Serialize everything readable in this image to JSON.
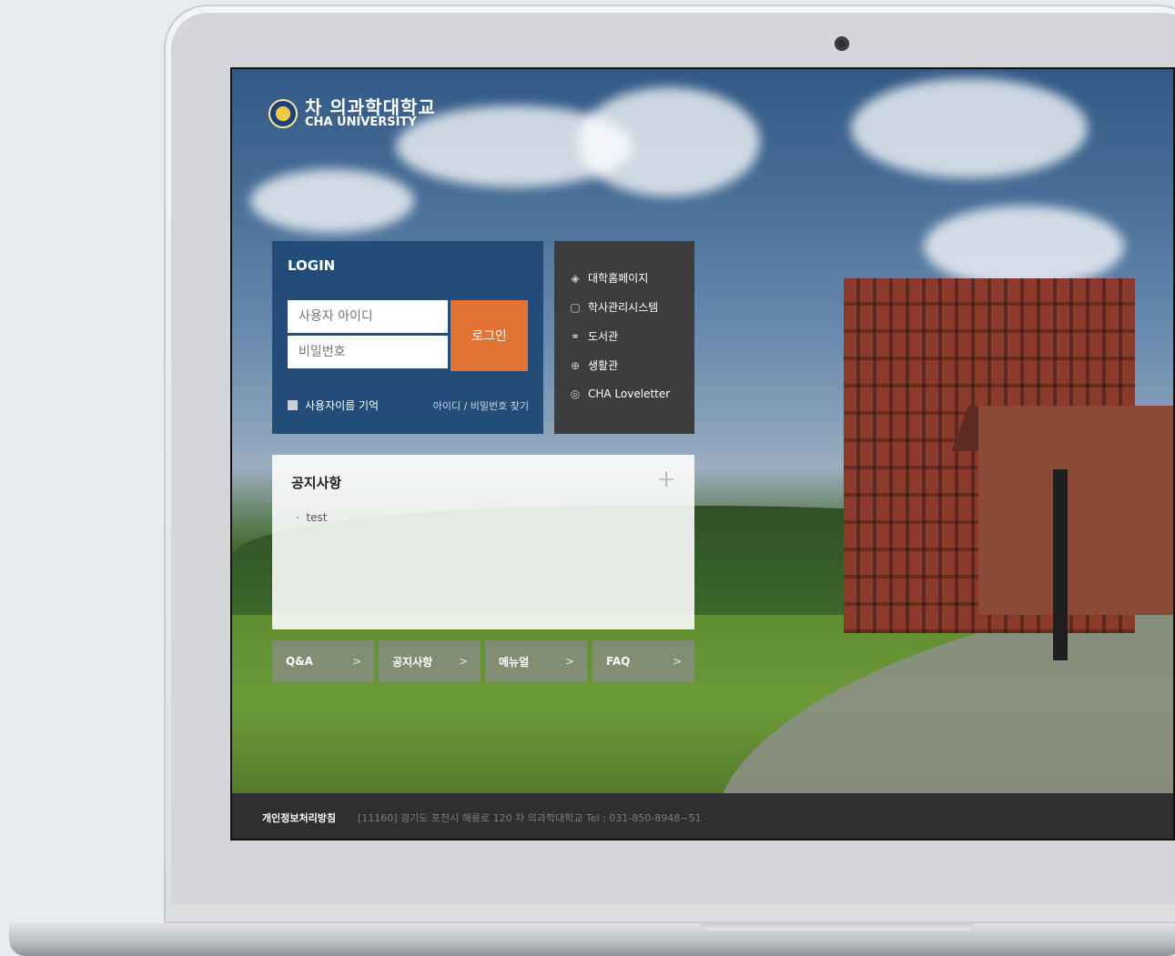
{
  "logo": {
    "name_ko": "차 의과학대학교",
    "name_en": "CHA UNIVERSITY"
  },
  "login": {
    "title": "LOGIN",
    "id_placeholder": "사용자 아이디",
    "pw_placeholder": "비밀번호",
    "button": "로그인",
    "remember_label": "사용자이름 기억",
    "find_link": "아이디 / 비밀번호 찾기"
  },
  "quick_links": [
    {
      "label": "대학홈페이지",
      "icon": "layers-icon"
    },
    {
      "label": "학사관리시스템",
      "icon": "window-icon"
    },
    {
      "label": "도서관",
      "icon": "link-icon"
    },
    {
      "label": "생활관",
      "icon": "crosshair-icon"
    },
    {
      "label": "CHA Loveletter",
      "icon": "globe-icon"
    }
  ],
  "notice": {
    "title": "공지사항",
    "more": "+",
    "items": [
      "test"
    ]
  },
  "shortcuts": [
    "Q&A",
    "공지사항",
    "메뉴얼",
    "FAQ"
  ],
  "footer": {
    "privacy": "개인정보처리방침",
    "info": "[11160] 경기도 포천시 해룡로 120 차 의과학대학교   Tel : 031-850-8948~51"
  },
  "colors": {
    "login_bg": "#234d78",
    "login_button": "#e37334",
    "quick_bg": "#3d3d3f",
    "footer_bg": "#2f2f31"
  }
}
